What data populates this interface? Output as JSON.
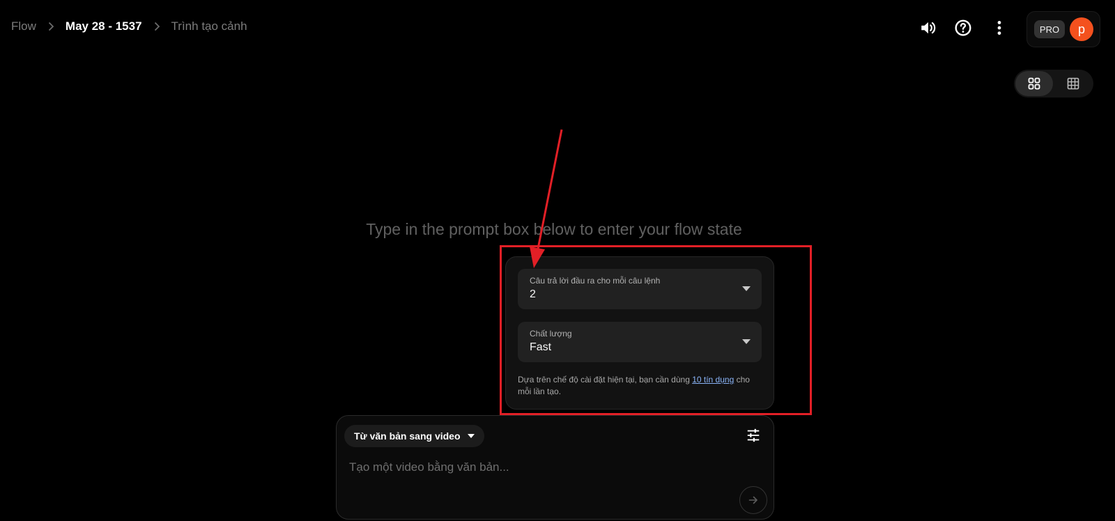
{
  "breadcrumb": {
    "root": "Flow",
    "project": "May 28 - 1537",
    "page": "Trình tạo cảnh"
  },
  "header": {
    "icons": [
      "speaker-icon",
      "help-icon",
      "more-vert-icon"
    ],
    "plan_badge": "PRO",
    "avatar_letter": "p"
  },
  "view_toggle": {
    "options": [
      "grid-2x2-icon",
      "grid-3x3-icon"
    ],
    "selected": 0
  },
  "main": {
    "hint": "Type in the prompt box below to enter your flow state"
  },
  "settings": {
    "outputs_label": "Câu trả lời đầu ra cho mỗi câu lệnh",
    "outputs_value": "2",
    "quality_label": "Chất lượng",
    "quality_value": "Fast",
    "credit_prefix": "Dựa trên chế độ cài đặt hiện tại, bạn cần dùng ",
    "credit_link": "10 tín dụng",
    "credit_suffix": " cho mỗi lần tạo."
  },
  "prompt": {
    "mode": "Từ văn bản sang video",
    "placeholder": "Tạo một video bằng văn bản...",
    "value": ""
  },
  "colors": {
    "background": "#000000",
    "avatar": "#f4511e",
    "annotation": "#e21f26",
    "link": "#8ab4f8"
  }
}
